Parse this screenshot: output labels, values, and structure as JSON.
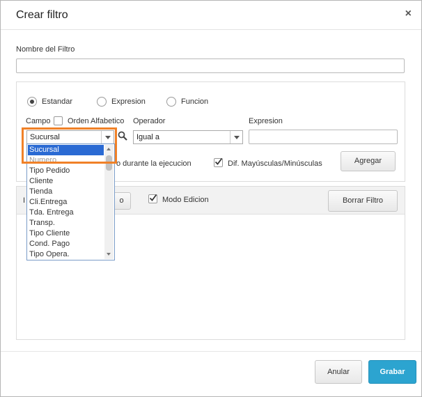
{
  "dialog": {
    "title": "Crear filtro",
    "close_label": "×"
  },
  "filter_name": {
    "label": "Nombre del Filtro",
    "value": ""
  },
  "type_options": [
    {
      "label": "Estandar",
      "checked": true
    },
    {
      "label": "Expresion",
      "checked": false
    },
    {
      "label": "Funcion",
      "checked": false
    }
  ],
  "campo": {
    "label": "Campo",
    "alphabetic_label": "Orden Alfabetico",
    "selected": "Sucursal",
    "options": [
      "Sucursal",
      "Numero",
      "Tipo Pedido",
      "Cliente",
      "Tienda",
      "Cli.Entrega",
      "Tda. Entrega",
      "Transp.",
      "Tipo Cliente",
      "Cond. Pago",
      "Tipo Opera."
    ]
  },
  "operador": {
    "label": "Operador",
    "selected": "Igual a"
  },
  "expresion": {
    "label": "Expresion",
    "value": ""
  },
  "options": {
    "ask_label": "o durante la ejecucion",
    "case_label": "Dif. Mayúsculas/Minúsculas",
    "case_checked": true
  },
  "buttons": {
    "agregar": "Agregar",
    "o_fragment": "o",
    "borrar": "Borrar Filtro",
    "anular": "Anular",
    "grabar": "Grabar"
  },
  "edit_mode": {
    "fragment": "I",
    "label": "Modo Edicion",
    "checked": true
  },
  "colors": {
    "accent": "#2ca4d0",
    "highlight": "#f08128",
    "selection": "#2a6ad3"
  }
}
